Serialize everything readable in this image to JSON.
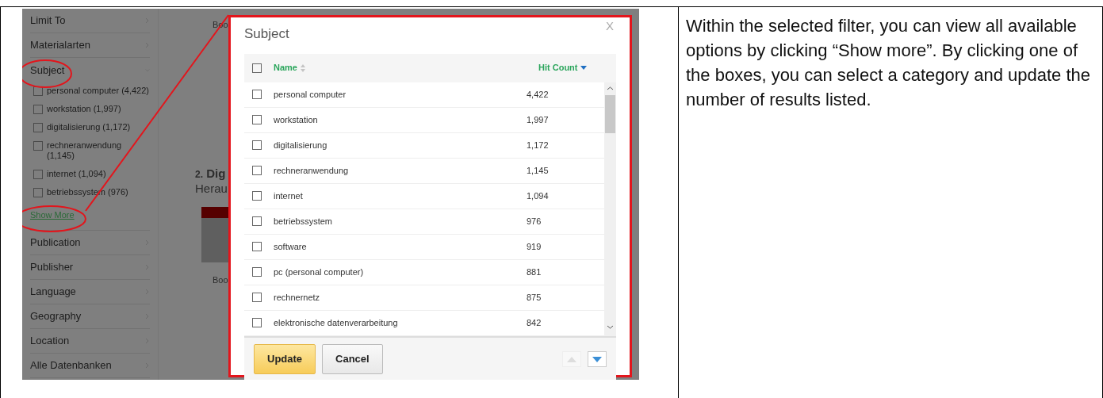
{
  "sidebar": {
    "items": [
      {
        "label": "Limit To",
        "expanded": false
      },
      {
        "label": "Materialarten",
        "expanded": false
      },
      {
        "label": "Subject",
        "expanded": true,
        "facets": [
          {
            "label": "personal computer (4,422)",
            "checked": false
          },
          {
            "label": "workstation (1,997)",
            "checked": false
          },
          {
            "label": "digitalisierung (1,172)",
            "checked": false
          },
          {
            "label": "rechneranwendung (1,145)",
            "checked": false
          },
          {
            "label": "internet (1,094)",
            "checked": false
          },
          {
            "label": "betriebssystem (976)",
            "checked": false
          }
        ],
        "show_more": "Show More"
      },
      {
        "label": "Publication",
        "expanded": false
      },
      {
        "label": "Publisher",
        "expanded": false
      },
      {
        "label": "Language",
        "expanded": false
      },
      {
        "label": "Geography",
        "expanded": false
      },
      {
        "label": "Location",
        "expanded": false
      },
      {
        "label": "Alle Datenbanken",
        "expanded": false
      }
    ]
  },
  "results": [
    {
      "kind": "type",
      "text": "Boo"
    },
    {
      "kind": "title",
      "number": "2.",
      "lines": [
        "Dig",
        "Herau"
      ]
    },
    {
      "kind": "cover"
    },
    {
      "kind": "type",
      "text": "Boo"
    }
  ],
  "modal": {
    "title": "Subject",
    "close": "X",
    "select_all": {
      "checked": false
    },
    "columns": [
      {
        "label": "Name",
        "sorted": false
      },
      {
        "label": "Hit Count",
        "sorted": true
      }
    ],
    "rows": [
      {
        "name": "personal computer",
        "count": "4,422",
        "checked": false
      },
      {
        "name": "workstation",
        "count": "1,997",
        "checked": false
      },
      {
        "name": "digitalisierung",
        "count": "1,172",
        "checked": false
      },
      {
        "name": "rechneranwendung",
        "count": "1,145",
        "checked": false
      },
      {
        "name": "internet",
        "count": "1,094",
        "checked": false
      },
      {
        "name": "betriebssystem",
        "count": "976",
        "checked": false
      },
      {
        "name": "software",
        "count": "919",
        "checked": false
      },
      {
        "name": "pc (personal computer)",
        "count": "881",
        "checked": false
      },
      {
        "name": "rechnernetz",
        "count": "875",
        "checked": false
      },
      {
        "name": "elektronische datenverarbeitung",
        "count": "842",
        "checked": false
      }
    ],
    "buttons": [
      {
        "label": "Update",
        "kind": "primary"
      },
      {
        "label": "Cancel",
        "kind": "secondary"
      }
    ],
    "pager": {
      "previous_disabled": true,
      "next_disabled": false
    }
  },
  "description": "Within the selected filter, you can view all available options by clicking “Show more”. By clicking one of the boxes, you can select a category and update the number of results listed."
}
